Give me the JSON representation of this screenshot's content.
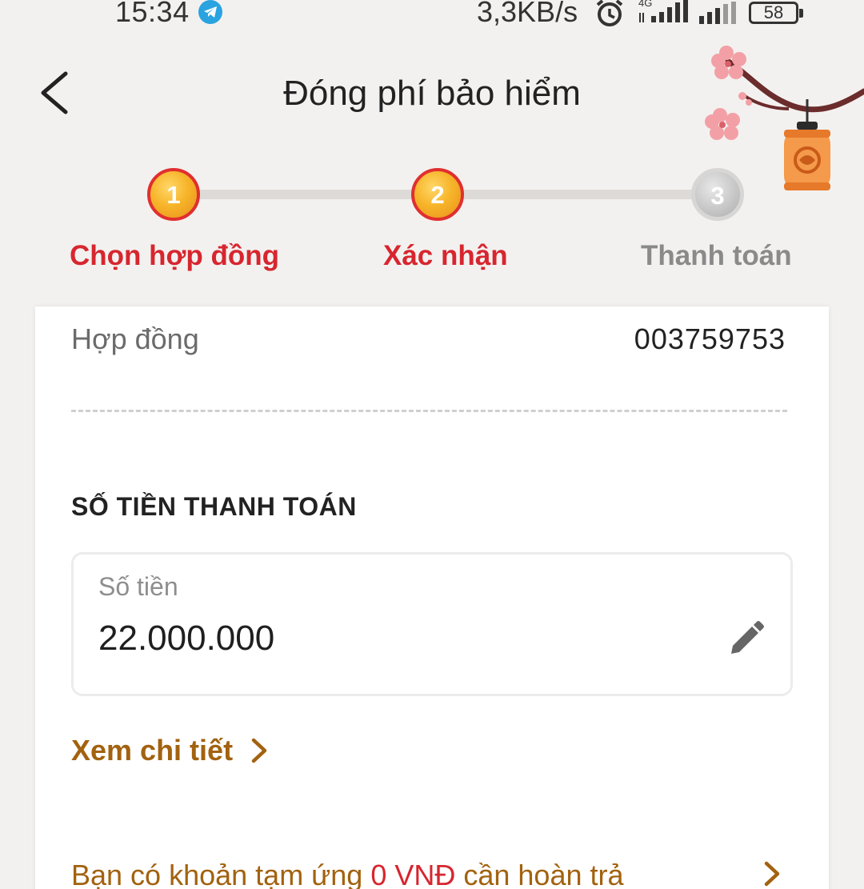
{
  "status_bar": {
    "time": "15:34",
    "speed": "3,3KB/s",
    "network": "4G",
    "battery": "58",
    "icons": [
      "telegram-icon",
      "alarm-icon",
      "signal-icon",
      "signal-icon",
      "battery-icon"
    ]
  },
  "header": {
    "title": "Đóng phí bảo hiểm",
    "back_icon": "chevron-left-icon"
  },
  "stepper": {
    "steps": [
      {
        "num": "1",
        "label": "Chọn hợp đồng",
        "state": "active"
      },
      {
        "num": "2",
        "label": "Xác nhận",
        "state": "active"
      },
      {
        "num": "3",
        "label": "Thanh toán",
        "state": "inactive"
      }
    ]
  },
  "contract": {
    "label": "Hợp đồng",
    "value": "003759753"
  },
  "payment": {
    "section_title": "SỐ TIỀN THANH TOÁN",
    "amount_label": "Số tiền",
    "amount_value": "22.000.000",
    "edit_icon": "pencil-icon"
  },
  "details_link": "Xem chi tiết",
  "advance": {
    "prefix": "Bạn có khoản tạm ứng ",
    "amount": "0 VNĐ",
    "suffix": " cần hoàn trả"
  },
  "colors": {
    "accent_red": "#d7262f",
    "link_brown": "#a2620f",
    "step_gold": "#f7b52a",
    "background": "#f3f1ef"
  }
}
